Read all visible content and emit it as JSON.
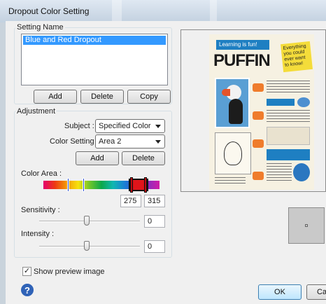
{
  "window": {
    "title": "Dropout Color Setting"
  },
  "setting_name": {
    "group_label": "Setting Name",
    "items": [
      "Blue and Red Dropout"
    ],
    "buttons": {
      "add": "Add",
      "delete": "Delete",
      "copy": "Copy"
    }
  },
  "adjustment": {
    "group_label": "Adjustment",
    "subject": {
      "label": "Subject :",
      "value": "Specified Color"
    },
    "color_setting": {
      "label": "Color Setting :",
      "value": "Area 2"
    },
    "buttons": {
      "add": "Add",
      "delete": "Delete"
    },
    "color_area": {
      "label": "Color Area :",
      "start": "275",
      "end": "315"
    },
    "sensitivity": {
      "label": "Sensitivity :",
      "value": "0"
    },
    "intensity": {
      "label": "Intensity :",
      "value": "0"
    }
  },
  "preview": {
    "show_label": "Show preview image",
    "checked": true,
    "poster": {
      "banner": "Learning is fun!",
      "title": "PUFFIN",
      "note": "Everything you could ever want to know!"
    }
  },
  "footer": {
    "ok": "OK",
    "cancel": "Ca",
    "help_glyph": "?"
  },
  "colors": {
    "selection": "#3399ff",
    "primary_button": "#bee6fd",
    "help": "#2f62b7",
    "poster_blue": "#1e7fc2"
  }
}
